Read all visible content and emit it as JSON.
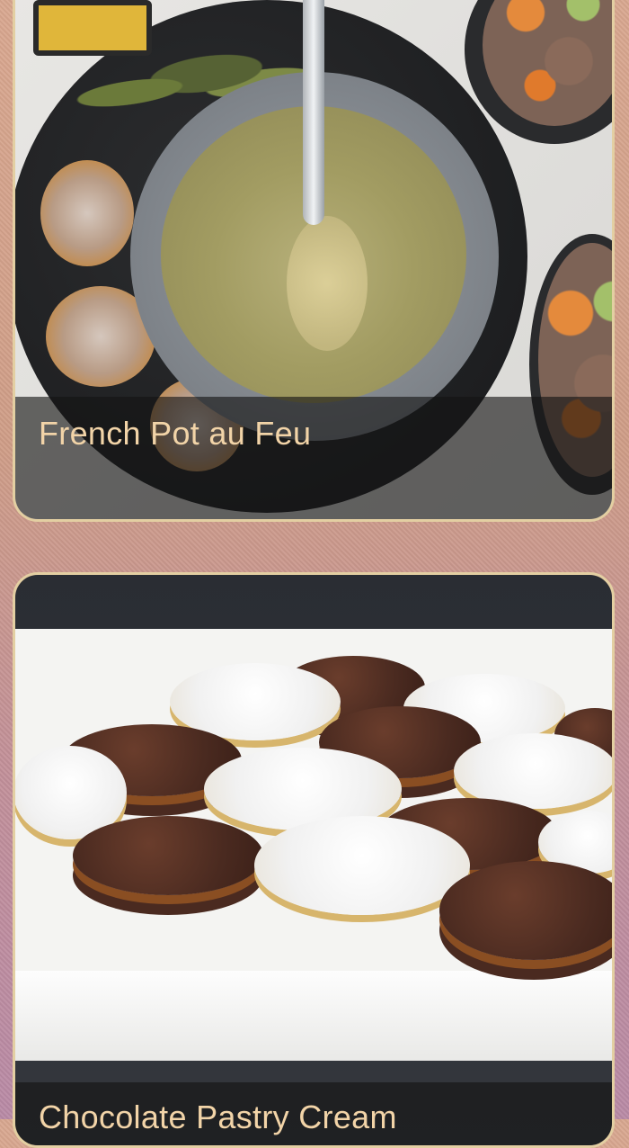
{
  "cards": [
    {
      "title": "French Pot au Feu",
      "image_subject": "bowl of broth with toasts and vegetables"
    },
    {
      "title": "Chocolate Pastry Cream",
      "image_subject": "plate of chocolate and sugar-dusted sandwich cookies"
    }
  ],
  "colors": {
    "card_border": "#e3cfa2",
    "caption_text": "#f2d4a8",
    "caption_bg": "rgba(20,20,20,0.62)"
  }
}
